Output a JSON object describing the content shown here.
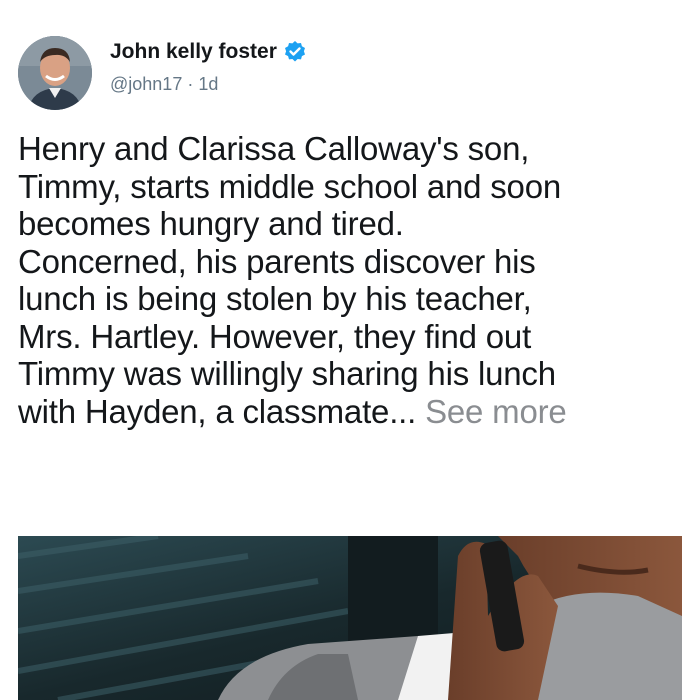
{
  "post": {
    "author": {
      "display_name": "John kelly foster",
      "handle": "@john17",
      "separator": " · ",
      "time_ago": "1d",
      "verified_icon": "verified-badge-icon",
      "verified_color": "#1da1f2"
    },
    "text_lines": [
      "Henry and Clarissa Calloway's son,",
      "Timmy, starts middle school and soon",
      "becomes hungry and tired.",
      "Concerned, his parents discover his",
      "lunch is being stolen by his teacher,",
      "Mrs. Hartley. However, they find out",
      "Timmy was willingly sharing his lunch",
      "with Hayden, a classmate..."
    ],
    "see_more_label": "See more"
  }
}
